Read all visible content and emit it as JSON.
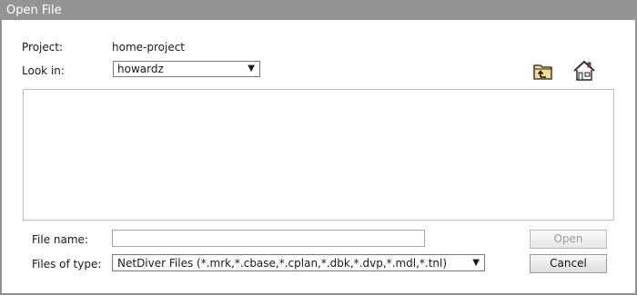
{
  "window": {
    "title": "Open File"
  },
  "project": {
    "label": "Project:",
    "value": "home-project"
  },
  "look_in": {
    "label": "Look in:",
    "value": "howardz"
  },
  "toolbar": {
    "up_folder_icon": "up-one-level-folder",
    "home_icon": "home"
  },
  "file_list": {
    "items": []
  },
  "file_name": {
    "label": "File name:",
    "value": ""
  },
  "files_of_type": {
    "label": "Files of type:",
    "value": "NetDiver Files (*.mrk,*.cbase,*.cplan,*.dbk,*.dvp,*.mdl,*.tnl)"
  },
  "buttons": {
    "open": "Open",
    "open_enabled": false,
    "cancel": "Cancel"
  },
  "colors": {
    "titlebar": "#949494",
    "title_text": "#ffffff",
    "folder_icon": "#f3dc8a"
  }
}
